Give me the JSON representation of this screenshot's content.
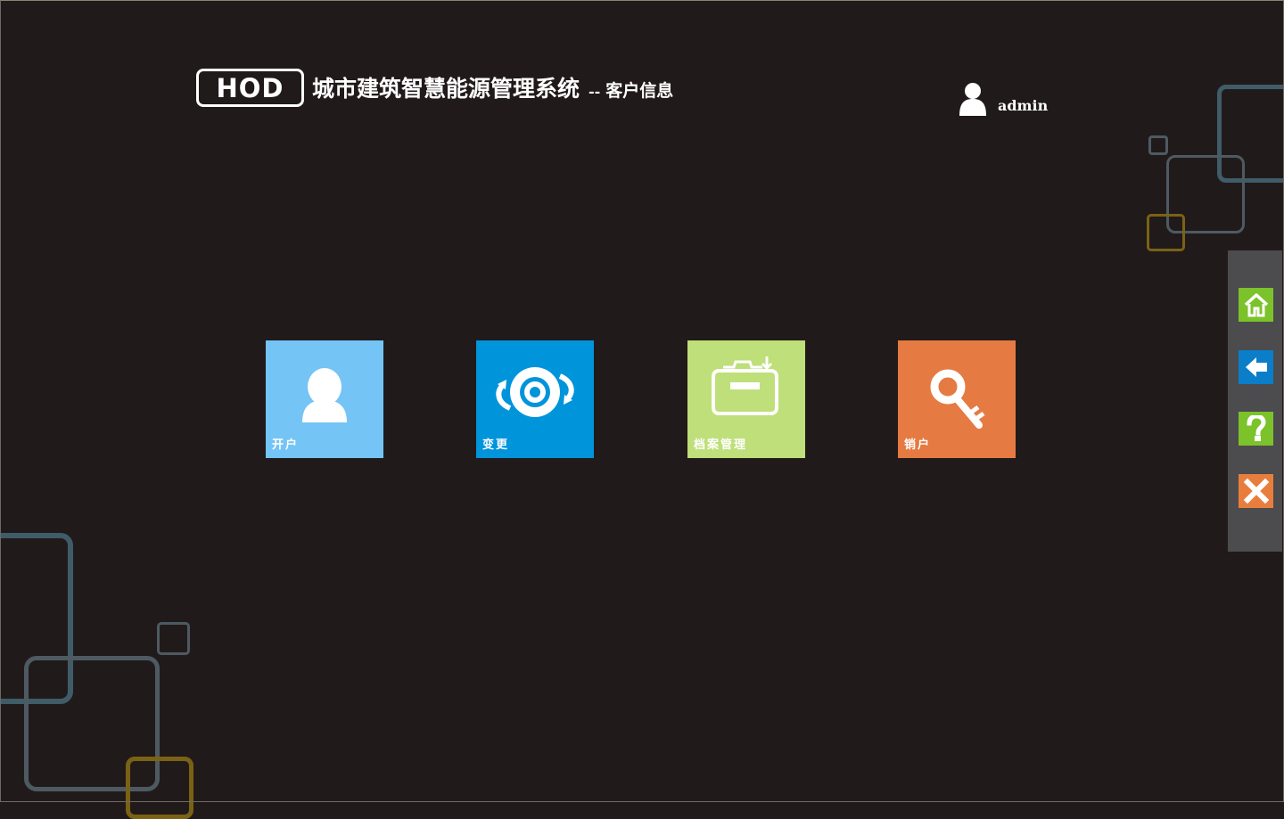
{
  "header": {
    "logo_text": "HOD",
    "system_title": "城市建筑智慧能源管理系统",
    "separator": "--",
    "page_subtitle": "客户信息"
  },
  "user": {
    "name": "admin",
    "icon": "user-icon"
  },
  "tiles": [
    {
      "label": "开户",
      "icon": "user-icon",
      "color": "#74c4f5"
    },
    {
      "label": "变更",
      "icon": "rotate-disc-icon",
      "color": "#0094db"
    },
    {
      "label": "档案管理",
      "icon": "archive-folder-icon",
      "color": "#bedf79"
    },
    {
      "label": "销户",
      "icon": "key-icon",
      "color": "#e57a42"
    }
  ],
  "side_panel": {
    "buttons": [
      {
        "icon": "home-icon",
        "color": "#7cc22b"
      },
      {
        "icon": "back-arrow-icon",
        "color": "#0a7ec9"
      },
      {
        "icon": "help-icon",
        "color": "#7cc22b"
      },
      {
        "icon": "close-icon",
        "color": "#e87e3e"
      }
    ]
  }
}
